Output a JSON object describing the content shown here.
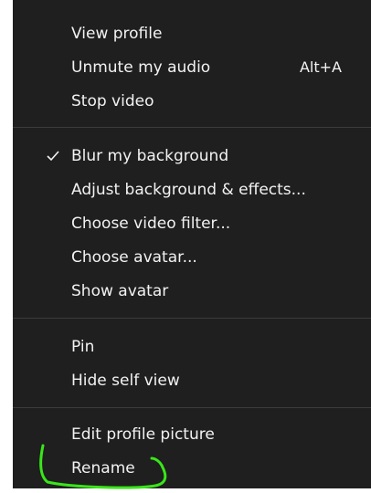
{
  "menu": {
    "group1": [
      {
        "label": "View profile"
      },
      {
        "label": "Unmute my audio",
        "shortcut": "Alt+A"
      },
      {
        "label": "Stop video"
      }
    ],
    "group2": [
      {
        "label": "Blur my background",
        "checked": true
      },
      {
        "label": "Adjust background & effects..."
      },
      {
        "label": "Choose video filter..."
      },
      {
        "label": "Choose avatar..."
      },
      {
        "label": "Show avatar"
      }
    ],
    "group3": [
      {
        "label": "Pin"
      },
      {
        "label": "Hide self view"
      }
    ],
    "group4": [
      {
        "label": "Edit profile picture"
      },
      {
        "label": "Rename",
        "annotated": true
      }
    ]
  },
  "colors": {
    "menu_bg": "#1f1f1f",
    "text": "#f2f2f2",
    "divider": "#3c3c3c",
    "annotation": "#39e619"
  },
  "icons": {
    "check": "checkmark-icon"
  }
}
